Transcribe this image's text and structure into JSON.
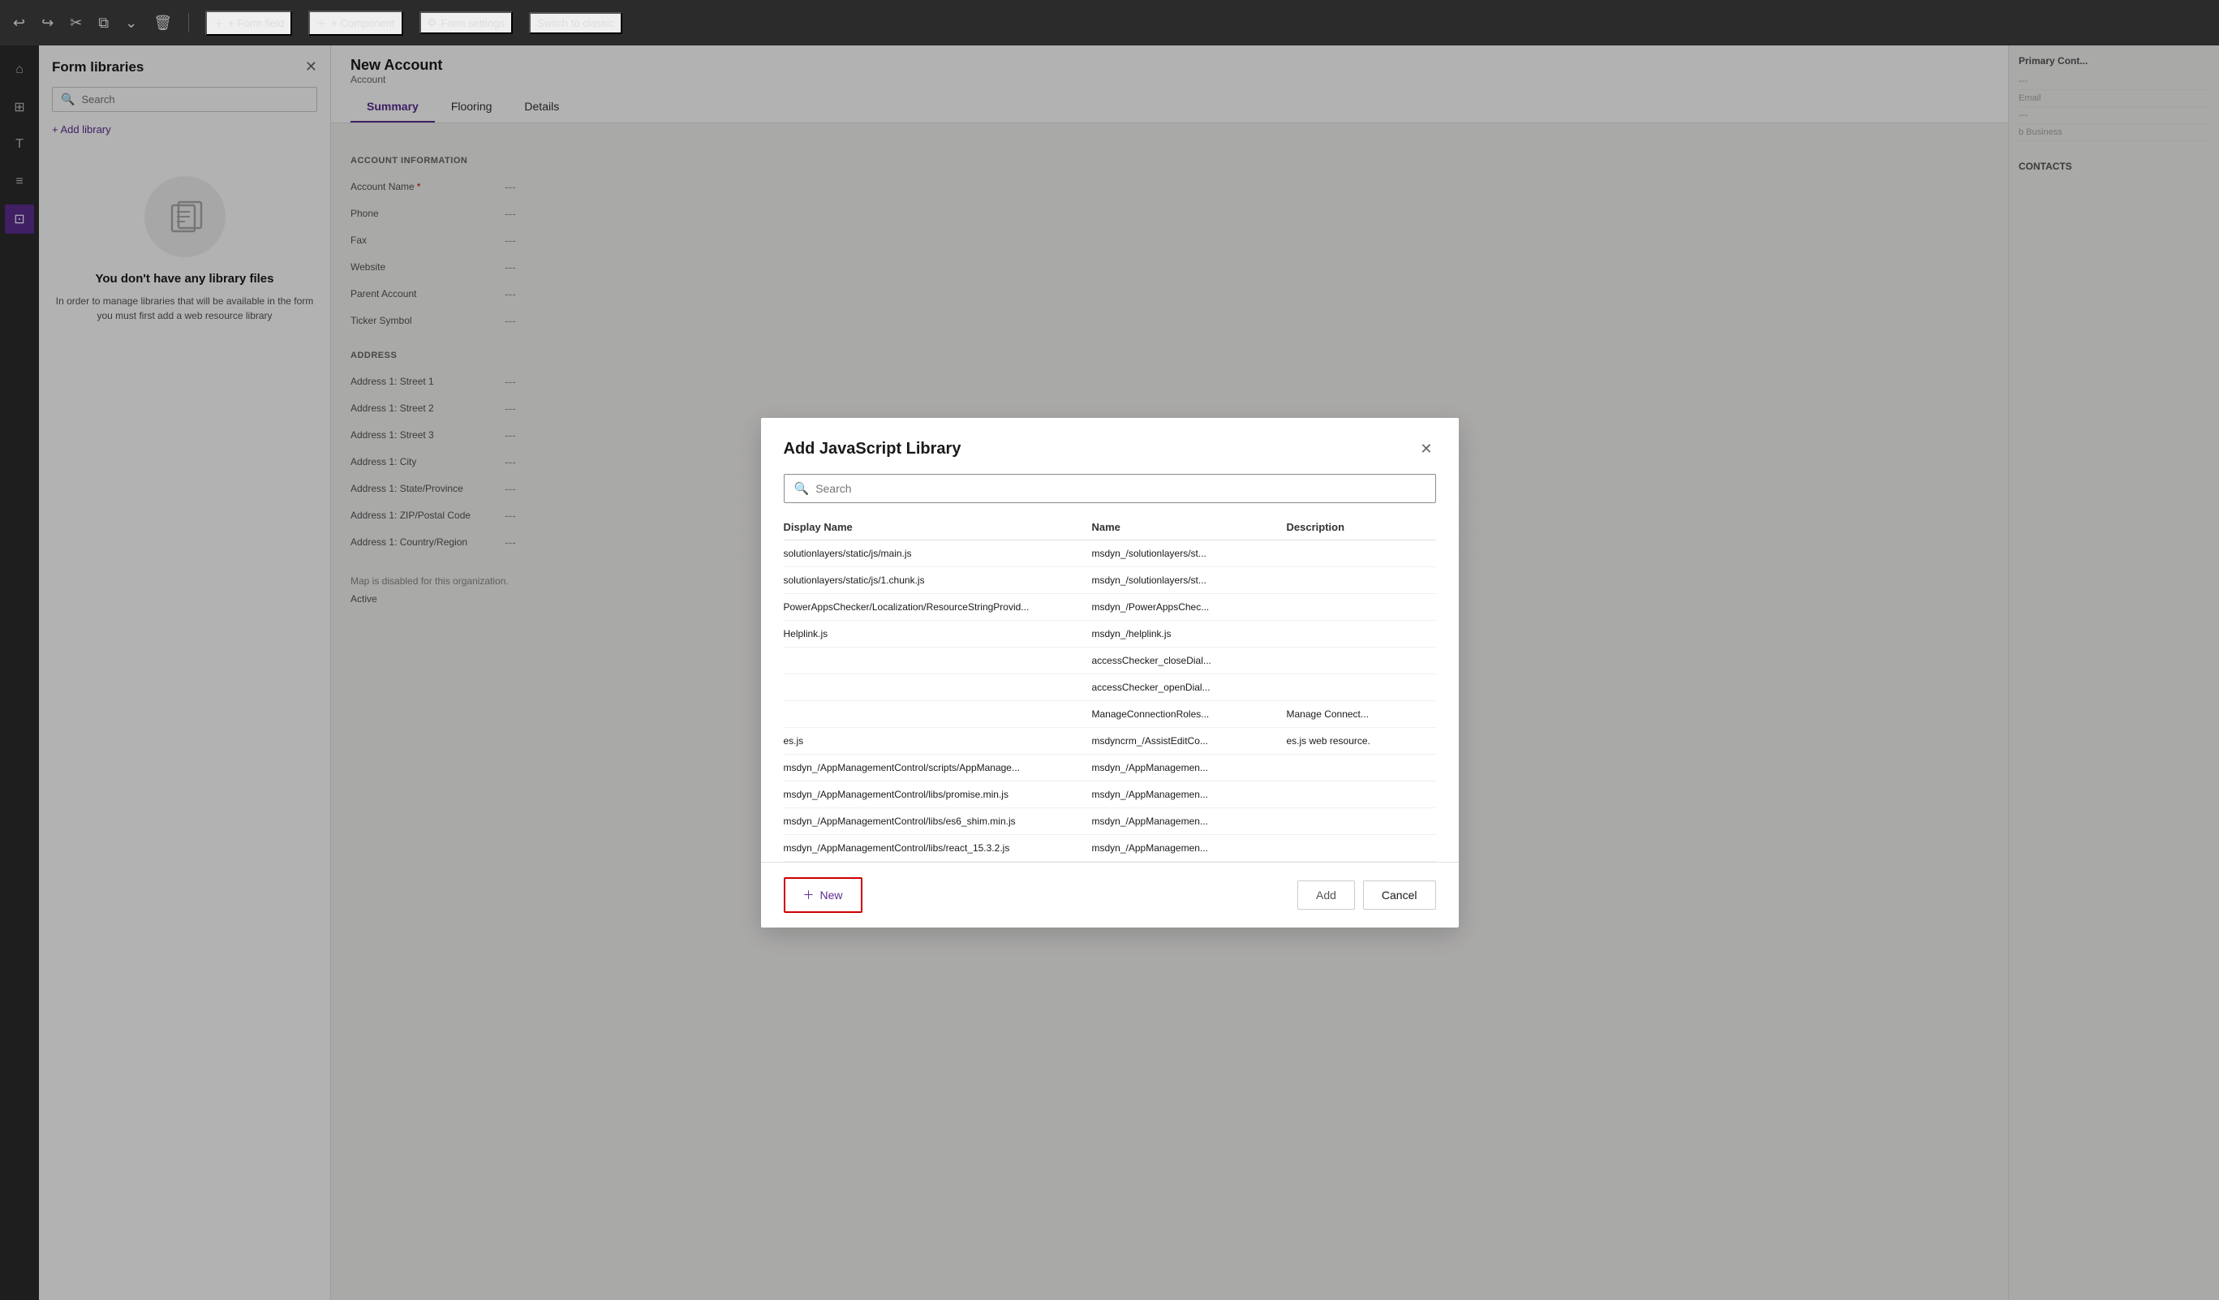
{
  "toolbar": {
    "buttons": [
      {
        "label": "+ Form field",
        "name": "form-field-btn"
      },
      {
        "label": "+ Component",
        "name": "component-btn"
      },
      {
        "label": "Form settings",
        "name": "form-settings-btn"
      },
      {
        "label": "Switch to classic",
        "name": "switch-classic-btn"
      }
    ]
  },
  "sidebar": {
    "title": "Form libraries",
    "search_placeholder": "Search",
    "add_library_label": "+ Add library",
    "empty_title": "You don't have any library files",
    "empty_desc": "In order to manage libraries that will be available in the form you must first add a web resource library"
  },
  "form": {
    "title": "New Account",
    "subtitle": "Account",
    "tabs": [
      "Summary",
      "Flooring",
      "Details"
    ],
    "active_tab": "Summary",
    "sections": [
      {
        "header": "ACCOUNT INFORMATION",
        "rows": [
          {
            "label": "Account Name",
            "value": "---",
            "required": true
          },
          {
            "label": "Phone",
            "value": "---"
          },
          {
            "label": "Fax",
            "value": "---"
          },
          {
            "label": "Website",
            "value": "---"
          },
          {
            "label": "Parent Account",
            "value": "---"
          },
          {
            "label": "Ticker Symbol",
            "value": "---"
          }
        ]
      },
      {
        "header": "ADDRESS",
        "rows": [
          {
            "label": "Address 1: Street 1",
            "value": "---"
          },
          {
            "label": "Address 1: Street 2",
            "value": "---"
          },
          {
            "label": "Address 1: Street 3",
            "value": "---"
          },
          {
            "label": "Address 1: City",
            "value": "---"
          },
          {
            "label": "Address 1: State/Province",
            "value": "---"
          },
          {
            "label": "Address 1: ZIP/Postal Code",
            "value": "---"
          },
          {
            "label": "Address 1: Country/Region",
            "value": "---"
          }
        ]
      }
    ],
    "map_notice": "Map is disabled for this organization.",
    "status": "Active"
  },
  "right_panel": {
    "title": "Primary Cont...",
    "rows": [
      "---",
      "Email",
      "---",
      "b Business"
    ]
  },
  "modal": {
    "title": "Add JavaScript Library",
    "search_placeholder": "Search",
    "columns": [
      "Display Name",
      "Name",
      "Description"
    ],
    "rows": [
      {
        "display_name": "solutionlayers/static/js/main.js",
        "name": "msdyn_/solutionlayers/st...",
        "description": ""
      },
      {
        "display_name": "solutionlayers/static/js/1.chunk.js",
        "name": "msdyn_/solutionlayers/st...",
        "description": ""
      },
      {
        "display_name": "PowerAppsChecker/Localization/ResourceStringProvid...",
        "name": "msdyn_/PowerAppsChec...",
        "description": ""
      },
      {
        "display_name": "Helplink.js",
        "name": "msdyn_/helplink.js",
        "description": ""
      },
      {
        "display_name": "",
        "name": "accessChecker_closeDial...",
        "description": ""
      },
      {
        "display_name": "",
        "name": "accessChecker_openDial...",
        "description": ""
      },
      {
        "display_name": "",
        "name": "ManageConnectionRoles...",
        "description": "Manage Connect..."
      },
      {
        "display_name": "es.js",
        "name": "msdyncrm_/AssistEditCo...",
        "description": "es.js web resource."
      },
      {
        "display_name": "msdyn_/AppManagementControl/scripts/AppManage...",
        "name": "msdyn_/AppManagemen...",
        "description": ""
      },
      {
        "display_name": "msdyn_/AppManagementControl/libs/promise.min.js",
        "name": "msdyn_/AppManagemen...",
        "description": ""
      },
      {
        "display_name": "msdyn_/AppManagementControl/libs/es6_shim.min.js",
        "name": "msdyn_/AppManagemen...",
        "description": ""
      },
      {
        "display_name": "msdyn_/AppManagementControl/libs/react_15.3.2.js",
        "name": "msdyn_/AppManagemen...",
        "description": ""
      }
    ],
    "footer": {
      "new_label": "New",
      "add_label": "Add",
      "cancel_label": "Cancel"
    }
  }
}
